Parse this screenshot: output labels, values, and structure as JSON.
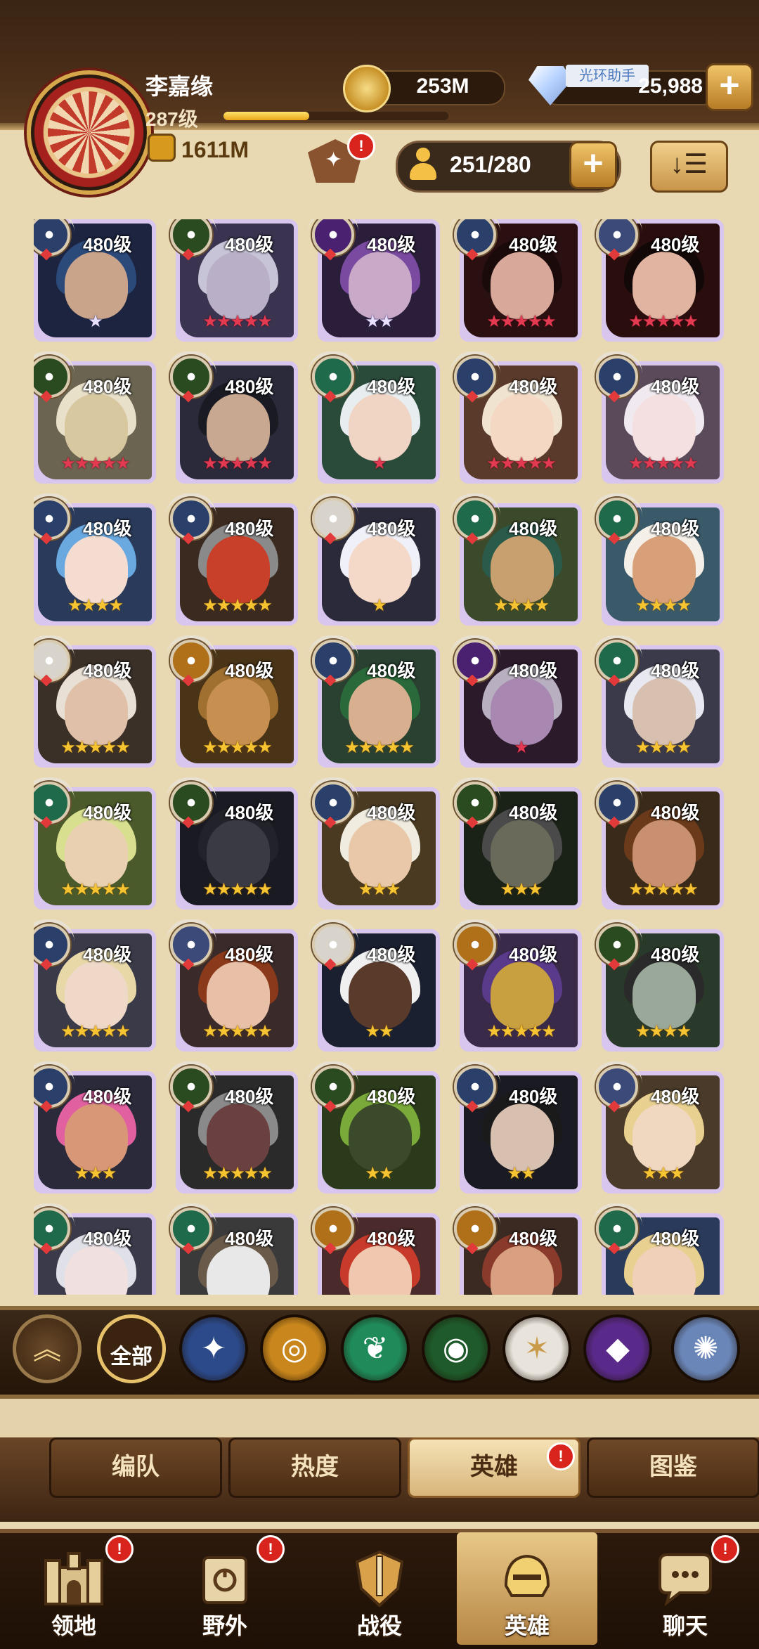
{
  "player": {
    "name": "李嘉缘",
    "level": "287级",
    "xp_progress": 0.38,
    "power": "1611M"
  },
  "currency": {
    "gold": "253M",
    "diamonds": "25,988",
    "helper_label": "光环助手"
  },
  "roster": {
    "count": "251/280"
  },
  "heroes": [
    {
      "level": "480级",
      "faction": "celestial",
      "stars": 1,
      "star_color": "white",
      "bg": "#1c2440",
      "hair": "#2b4a7a",
      "skin": "#c9a38a"
    },
    {
      "level": "480级",
      "faction": "forest",
      "stars": 5,
      "star_color": "red",
      "bg": "#3a3450",
      "hair": "#c8c4d8",
      "skin": "#b9b0c8"
    },
    {
      "level": "480级",
      "faction": "void",
      "stars": 2,
      "star_color": "white",
      "bg": "#2a1e3a",
      "hair": "#7a4aa0",
      "skin": "#c8aac8"
    },
    {
      "level": "480级",
      "faction": "celestial",
      "stars": 5,
      "star_color": "red",
      "bg": "#2a1010",
      "hair": "#1a0a0a",
      "skin": "#d8a89a"
    },
    {
      "level": "480级",
      "faction": "dimensional",
      "stars": 5,
      "star_color": "red",
      "bg": "#2a0e0e",
      "hair": "#120808",
      "skin": "#e0b4a0"
    },
    {
      "level": "480级",
      "faction": "forest",
      "stars": 5,
      "star_color": "red",
      "bg": "#6a6450",
      "hair": "#e8e0c8",
      "skin": "#d8c8a0"
    },
    {
      "level": "480级",
      "faction": "forest",
      "stars": 5,
      "star_color": "red",
      "bg": "#2a2a3a",
      "hair": "#1a1a22",
      "skin": "#c8a890"
    },
    {
      "level": "480级",
      "faction": "wilder",
      "stars": 1,
      "star_color": "red",
      "bg": "#2a4a3a",
      "hair": "#e8eef0",
      "skin": "#f0d4c4"
    },
    {
      "level": "480级",
      "faction": "celestial",
      "stars": 5,
      "star_color": "red",
      "bg": "#5a3a2a",
      "hair": "#f0e4d0",
      "skin": "#f4d8c4"
    },
    {
      "level": "480级",
      "faction": "celestial",
      "stars": 5,
      "star_color": "red",
      "bg": "#5a4a5a",
      "hair": "#f0eaf0",
      "skin": "#f4e0e0"
    },
    {
      "level": "480级",
      "faction": "celestial",
      "stars": 4,
      "star_color": "gold",
      "bg": "#2a3a5a",
      "hair": "#6aa8e0",
      "skin": "#f4dcd0"
    },
    {
      "level": "480级",
      "faction": "celestial",
      "stars": 5,
      "star_color": "gold",
      "bg": "#3a2a20",
      "hair": "#8a8a8a",
      "skin": "#c8402a"
    },
    {
      "level": "480级",
      "faction": "lightbearer",
      "stars": 1,
      "star_color": "gold",
      "bg": "#2a2a3a",
      "hair": "#f0f0f8",
      "skin": "#f4d8c8"
    },
    {
      "level": "480级",
      "faction": "wilder",
      "stars": 4,
      "star_color": "gold",
      "bg": "#3a4a2a",
      "hair": "#2a5a4a",
      "skin": "#c8a070"
    },
    {
      "level": "480级",
      "faction": "wilder",
      "stars": 4,
      "star_color": "gold",
      "bg": "#3a5a6a",
      "hair": "#f4f0e8",
      "skin": "#d8a078"
    },
    {
      "level": "480级",
      "faction": "lightbearer",
      "stars": 5,
      "star_color": "gold",
      "bg": "#3a3028",
      "hair": "#e8e0d4",
      "skin": "#e0c0a8"
    },
    {
      "level": "480级",
      "faction": "graveborn",
      "stars": 5,
      "star_color": "gold",
      "bg": "#4a3418",
      "hair": "#a07030",
      "skin": "#c89050"
    },
    {
      "level": "480级",
      "faction": "celestial",
      "stars": 5,
      "star_color": "gold",
      "bg": "#2a4030",
      "hair": "#2a6a3a",
      "skin": "#d8b090"
    },
    {
      "level": "480级",
      "faction": "void",
      "stars": 1,
      "star_color": "red",
      "bg": "#2a1a2a",
      "hair": "#b8b0c0",
      "skin": "#a888b0"
    },
    {
      "level": "480级",
      "faction": "wilder",
      "stars": 4,
      "star_color": "gold",
      "bg": "#3a3a4a",
      "hair": "#e8e8f0",
      "skin": "#d8c0b0"
    },
    {
      "level": "480级",
      "faction": "wilder",
      "stars": 5,
      "star_color": "gold",
      "bg": "#4a5a2a",
      "hair": "#d8e090",
      "skin": "#e8d0b0"
    },
    {
      "level": "480级",
      "faction": "forest",
      "stars": 5,
      "star_color": "gold",
      "bg": "#1a1a22",
      "hair": "#22222a",
      "skin": "#3a3a44"
    },
    {
      "level": "480级",
      "faction": "celestial",
      "stars": 3,
      "star_color": "gold",
      "bg": "#4a3a22",
      "hair": "#f0ece0",
      "skin": "#e8c8a8"
    },
    {
      "level": "480级",
      "faction": "forest",
      "stars": 3,
      "star_color": "gold",
      "bg": "#1a2218",
      "hair": "#4a4a4a",
      "skin": "#6a6a5a"
    },
    {
      "level": "480级",
      "faction": "celestial",
      "stars": 5,
      "star_color": "gold",
      "bg": "#3a2a1a",
      "hair": "#6a3a1a",
      "skin": "#c89070"
    },
    {
      "level": "480级",
      "faction": "celestial",
      "stars": 5,
      "star_color": "gold",
      "bg": "#3a3a48",
      "hair": "#e8d8a8",
      "skin": "#f0d8c8"
    },
    {
      "level": "480级",
      "faction": "dimensional",
      "stars": 5,
      "star_color": "gold",
      "bg": "#3a2a2a",
      "hair": "#8a3a1a",
      "skin": "#e8c0a8"
    },
    {
      "level": "480级",
      "faction": "lightbearer",
      "stars": 2,
      "star_color": "gold",
      "bg": "#1a2030",
      "hair": "#f0f0f0",
      "skin": "#5a3a2a"
    },
    {
      "level": "480级",
      "faction": "graveborn",
      "stars": 5,
      "star_color": "gold",
      "bg": "#3a2a4a",
      "hair": "#5a3a8a",
      "skin": "#c8a040"
    },
    {
      "level": "480级",
      "faction": "forest",
      "stars": 4,
      "star_color": "gold",
      "bg": "#2a3a2a",
      "hair": "#2a2a2a",
      "skin": "#9aa89a"
    },
    {
      "level": "480级",
      "faction": "celestial",
      "stars": 3,
      "star_color": "gold",
      "bg": "#2a2a3a",
      "hair": "#e060a0",
      "skin": "#d89878"
    },
    {
      "level": "480级",
      "faction": "forest",
      "stars": 5,
      "star_color": "gold",
      "bg": "#2a2a2a",
      "hair": "#8a8a8a",
      "skin": "#6a4040"
    },
    {
      "level": "480级",
      "faction": "forest",
      "stars": 2,
      "star_color": "gold",
      "bg": "#2a3a1a",
      "hair": "#7aaa3a",
      "skin": "#3a4a2a"
    },
    {
      "level": "480级",
      "faction": "celestial",
      "stars": 2,
      "star_color": "gold",
      "bg": "#1a1a22",
      "hair": "#1a1a1a",
      "skin": "#d8c0b0"
    },
    {
      "level": "480级",
      "faction": "dimensional",
      "stars": 3,
      "star_color": "gold",
      "bg": "#4a3a2a",
      "hair": "#e8d090",
      "skin": "#f0d8c0"
    },
    {
      "level": "480级",
      "faction": "wilder",
      "stars": 0,
      "star_color": "gold",
      "bg": "#3a3a4a",
      "hair": "#e0e0e8",
      "skin": "#f0e0e0"
    },
    {
      "level": "480级",
      "faction": "wilder",
      "stars": 0,
      "star_color": "gold",
      "bg": "#3a3a3a",
      "hair": "#6a5a4a",
      "skin": "#e8e8e8"
    },
    {
      "level": "480级",
      "faction": "graveborn",
      "stars": 0,
      "star_color": "gold",
      "bg": "#4a2a2a",
      "hair": "#c83a2a",
      "skin": "#f0c8b0"
    },
    {
      "level": "480级",
      "faction": "graveborn",
      "stars": 0,
      "star_color": "gold",
      "bg": "#3a2a22",
      "hair": "#8a3a2a",
      "skin": "#d8a080"
    },
    {
      "level": "480级",
      "faction": "wilder",
      "stars": 0,
      "star_color": "gold",
      "bg": "#2a3a5a",
      "hair": "#e8d090",
      "skin": "#f0d0b8"
    }
  ],
  "faction_colors": {
    "celestial": "#2a3f6a",
    "forest": "#2a4a20",
    "void": "#4a2070",
    "dimensional": "#3c4a7a",
    "wilder": "#1f6a4a",
    "lightbearer": "#d8d4cc",
    "graveborn": "#b0701a"
  },
  "filters": {
    "all_label": "全部",
    "items": [
      {
        "name": "lightbearer",
        "color": "#2c4a8a",
        "glyph": "✦"
      },
      {
        "name": "mauler",
        "color": "#c8861c",
        "glyph": "◎"
      },
      {
        "name": "wilder",
        "color": "#1f8a5a",
        "glyph": "❦"
      },
      {
        "name": "graveborn",
        "color": "#1e5a2a",
        "glyph": "◉"
      },
      {
        "name": "celestial",
        "color": "#e8e4dc",
        "glyph": "✶"
      },
      {
        "name": "hypogean",
        "color": "#5a2a8a",
        "glyph": "◆"
      },
      {
        "name": "dimensional",
        "color": "#6a86b8",
        "glyph": "✺"
      }
    ]
  },
  "subtabs": [
    "编队",
    "热度",
    "英雄",
    "图鉴"
  ],
  "nav": [
    {
      "label": "领地",
      "badge": "!"
    },
    {
      "label": "野外",
      "badge": "!"
    },
    {
      "label": "战役",
      "badge": ""
    },
    {
      "label": "英雄",
      "badge": ""
    },
    {
      "label": "聊天",
      "badge": "!"
    }
  ],
  "badge_text": "!"
}
